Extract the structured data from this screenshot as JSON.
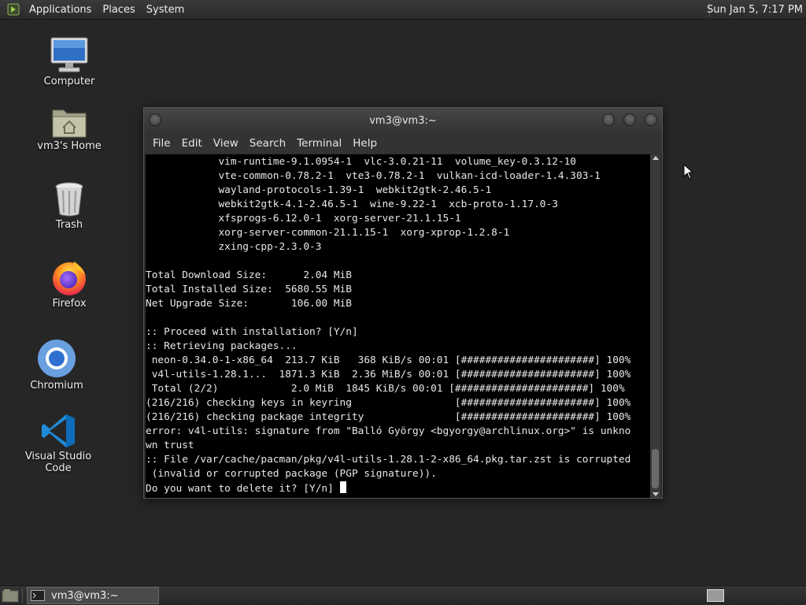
{
  "top_panel": {
    "menus": [
      "Applications",
      "Places",
      "System"
    ],
    "clock": "Sun Jan  5,  7:17 PM"
  },
  "desktop_icons": [
    {
      "label": "Computer",
      "icon": "computer-icon"
    },
    {
      "label": "vm3's Home",
      "icon": "home-folder-icon"
    },
    {
      "label": "Trash",
      "icon": "trash-icon"
    },
    {
      "label": "Firefox",
      "icon": "firefox-icon"
    },
    {
      "label": "Chromium",
      "icon": "chromium-icon"
    },
    {
      "label": "Visual Studio Code",
      "icon": "vscode-icon"
    }
  ],
  "window": {
    "title": "vm3@vm3:~",
    "menus": [
      "File",
      "Edit",
      "View",
      "Search",
      "Terminal",
      "Help"
    ],
    "terminal_lines": [
      "            vim-runtime-9.1.0954-1  vlc-3.0.21-11  volume_key-0.3.12-10",
      "            vte-common-0.78.2-1  vte3-0.78.2-1  vulkan-icd-loader-1.4.303-1",
      "            wayland-protocols-1.39-1  webkit2gtk-2.46.5-1",
      "            webkit2gtk-4.1-2.46.5-1  wine-9.22-1  xcb-proto-1.17.0-3",
      "            xfsprogs-6.12.0-1  xorg-server-21.1.15-1",
      "            xorg-server-common-21.1.15-1  xorg-xprop-1.2.8-1",
      "            zxing-cpp-2.3.0-3",
      "",
      "Total Download Size:      2.04 MiB",
      "Total Installed Size:  5680.55 MiB",
      "Net Upgrade Size:       106.00 MiB",
      "",
      ":: Proceed with installation? [Y/n]",
      ":: Retrieving packages...",
      " neon-0.34.0-1-x86_64  213.7 KiB   368 KiB/s 00:01 [######################] 100%",
      " v4l-utils-1.28.1...  1871.3 KiB  2.36 MiB/s 00:01 [######################] 100%",
      " Total (2/2)            2.0 MiB  1845 KiB/s 00:01 [######################] 100%",
      "(216/216) checking keys in keyring                 [######################] 100%",
      "(216/216) checking package integrity               [######################] 100%",
      "error: v4l-utils: signature from \"Balló György <bgyorgy@archlinux.org>\" is unkno",
      "wn trust",
      ":: File /var/cache/pacman/pkg/v4l-utils-1.28.1-2-x86_64.pkg.tar.zst is corrupted",
      " (invalid or corrupted package (PGP signature)).",
      "Do you want to delete it? [Y/n] "
    ]
  },
  "bottom_panel": {
    "task_label": "vm3@vm3:~"
  }
}
